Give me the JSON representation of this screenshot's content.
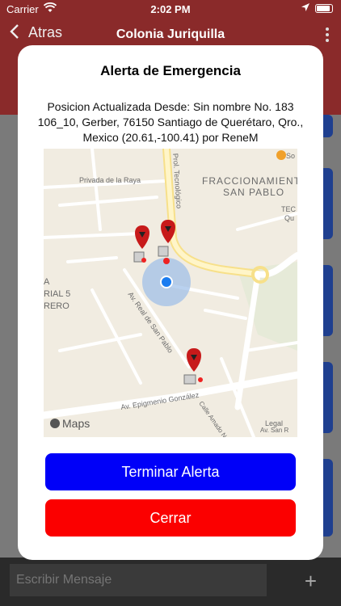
{
  "status_bar": {
    "carrier": "Carrier",
    "time": "2:02 PM"
  },
  "nav": {
    "back_label": "Atras",
    "title": "Colonia Juriquilla"
  },
  "bottom_bar": {
    "message_placeholder": "Escribir Mensaje",
    "add_label": "+"
  },
  "modal": {
    "title": "Alerta de Emergencia",
    "message": "Posicion Actualizada Desde: Sin nombre No. 183 106_10, Gerber, 76150 Santiago de Querétaro, Qro., Mexico (20.61,-100.41) por ReneM",
    "terminate_button": "Terminar Alerta",
    "close_button": "Cerrar"
  },
  "map": {
    "labels": {
      "fracc": "FRACCIONAMIENTO",
      "san_pablo": "SAN PABLO",
      "privada": "Privada de la Raya",
      "prol": "Prol. Tecnológico",
      "av_real": "Av. Real de San Pablo",
      "av_epig": "Av. Epigmenio González",
      "calle": "Calle Amado N",
      "legal": "Legal",
      "av_san": "Av. San R",
      "left_a": "A",
      "left_rial": "RIAL 5",
      "left_rero": "RERO",
      "tec": "TEC",
      "qu": "Qu",
      "so": "So",
      "maps": "Maps"
    }
  },
  "colors": {
    "header": "#8a2a2a",
    "primary_button": "#0000f8",
    "danger_button": "#fb0000",
    "map_bg": "#f1ece1",
    "card": "#1f3f8f"
  }
}
